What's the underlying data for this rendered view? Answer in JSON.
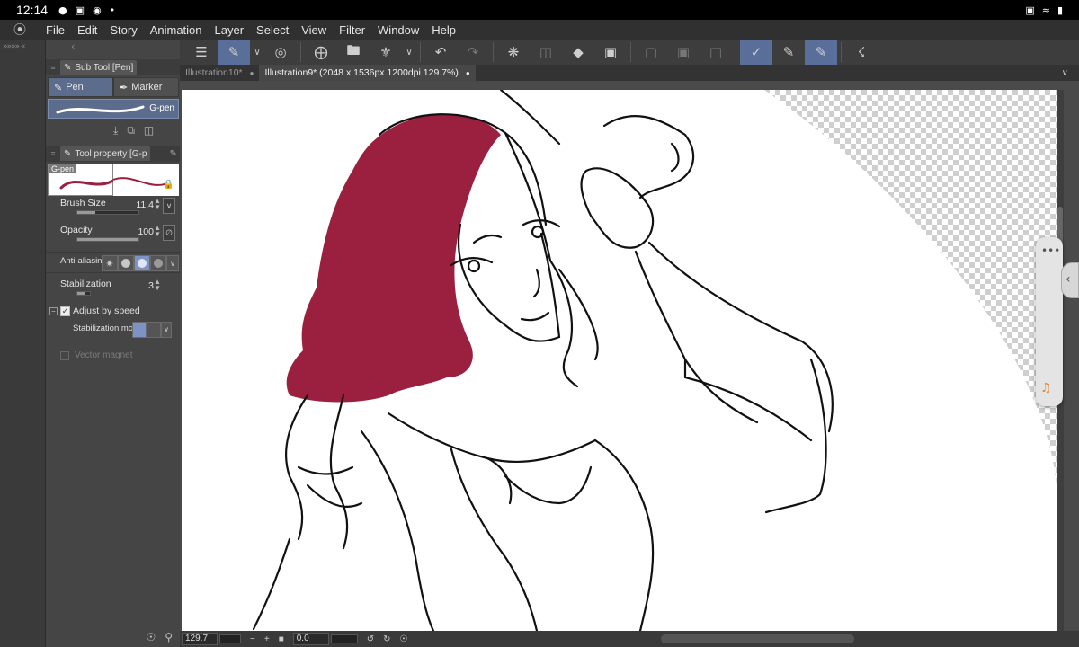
{
  "status_bar": {
    "time": "12:14"
  },
  "menu": {
    "items": [
      "File",
      "Edit",
      "Story",
      "Animation",
      "Layer",
      "Select",
      "View",
      "Filter",
      "Window",
      "Help"
    ]
  },
  "sub_tool": {
    "title": "Sub Tool [Pen]",
    "tabs": [
      {
        "label": "Pen",
        "active": true
      },
      {
        "label": "Marker",
        "active": false
      }
    ],
    "selected": "G-pen"
  },
  "tool_property": {
    "title": "Tool property [G-p",
    "preview_label": "G-pen",
    "brush_size": {
      "label": "Brush Size",
      "value": "11.4"
    },
    "opacity": {
      "label": "Opacity",
      "value": "100"
    },
    "anti_aliasing": {
      "label": "Anti-aliasing"
    },
    "stabilization": {
      "label": "Stabilization",
      "value": "3"
    },
    "adjust_by_speed": {
      "label": "Adjust by speed",
      "checked": true
    },
    "stabilization_mode": {
      "label": "Stabilization mode"
    },
    "vector_magnet": {
      "label": "Vector magnet"
    }
  },
  "tabs": [
    {
      "label": "Illustration10*",
      "active": false
    },
    {
      "label": "Illustration9* (2048 x 1536px 1200dpi 129.7%)",
      "active": true
    }
  ],
  "bottom": {
    "zoom": "129.7",
    "rotation": "0.0"
  },
  "colors": {
    "hair": "#9b1f3e",
    "accent": "#5a6e9a",
    "canvas": "#ffffff"
  }
}
